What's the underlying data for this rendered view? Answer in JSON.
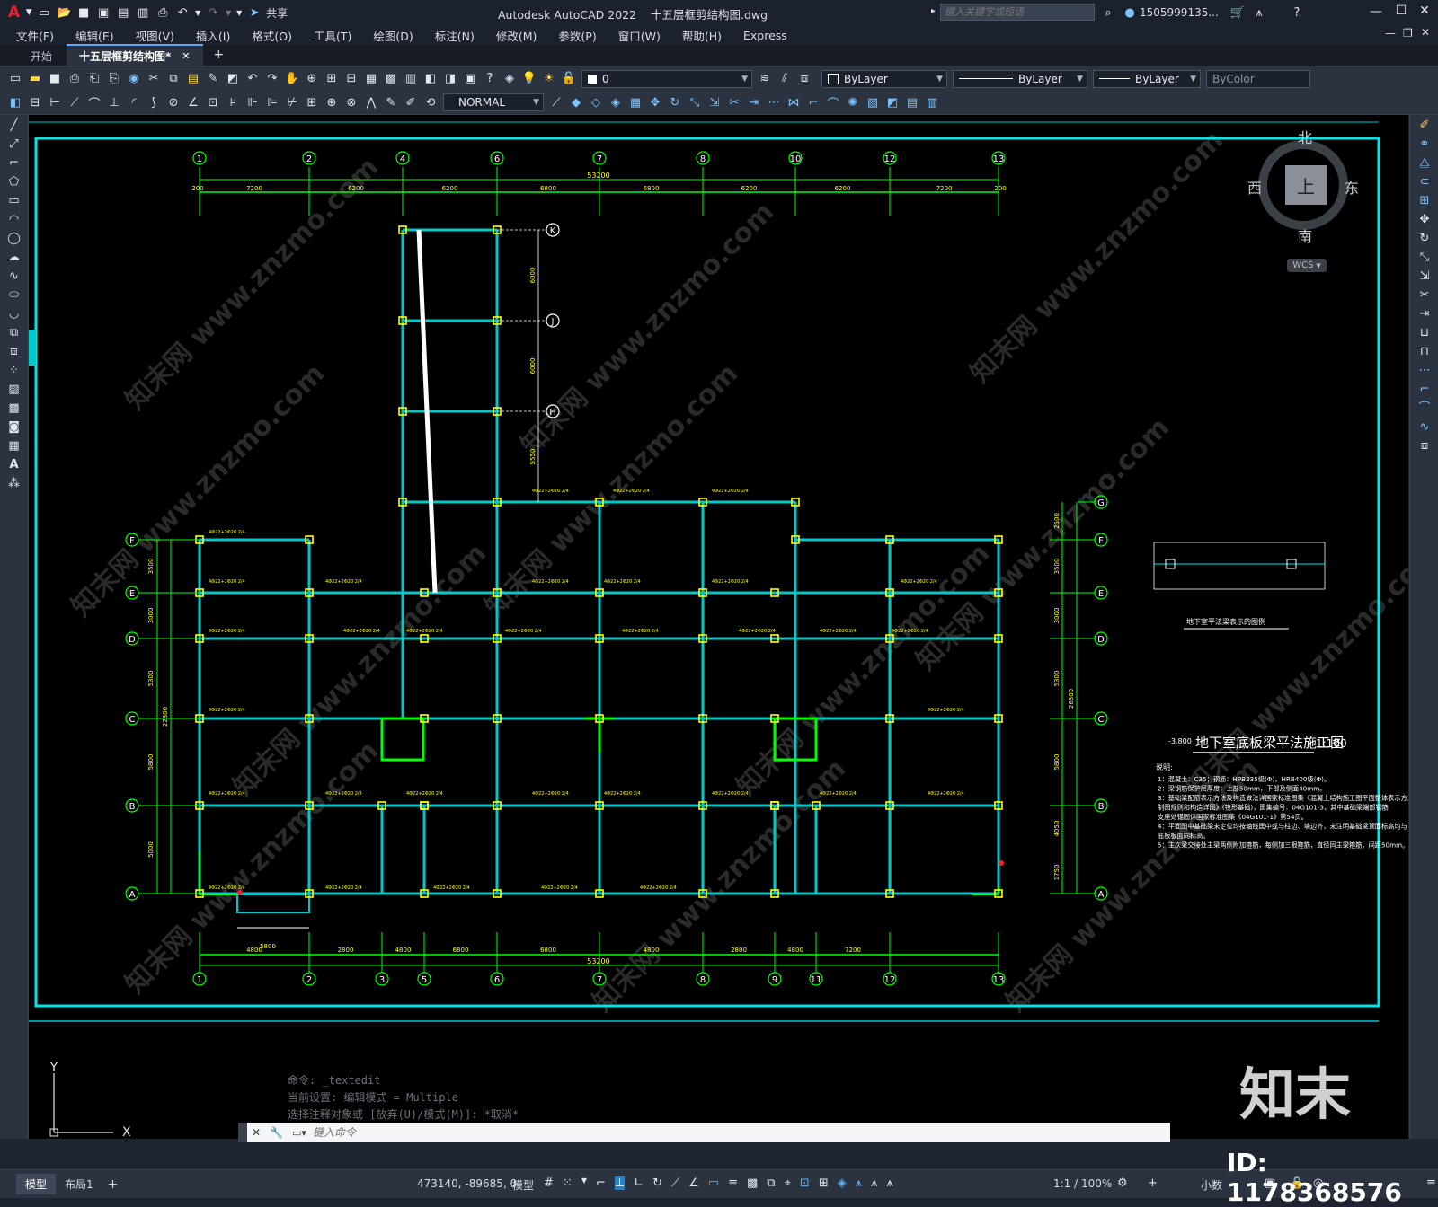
{
  "app": {
    "title": "Autodesk AutoCAD 2022",
    "filename": "十五层框剪结构图.dwg",
    "share_label": "共享",
    "search_placeholder": "键入关键字或短语",
    "user": "1505999135...",
    "logo": "A"
  },
  "menu": [
    "文件(F)",
    "编辑(E)",
    "视图(V)",
    "插入(I)",
    "格式(O)",
    "工具(T)",
    "绘图(D)",
    "标注(N)",
    "修改(M)",
    "参数(P)",
    "窗口(W)",
    "帮助(H)",
    "Express"
  ],
  "tabs": [
    {
      "label": "开始",
      "active": false
    },
    {
      "label": "十五层框剪结构图*",
      "active": true
    }
  ],
  "toolbar": {
    "layer_value": "0",
    "color_value": "ByLayer",
    "linetype_value": "ByLayer",
    "lineweight_value": "ByLayer",
    "plotstyle_value": "ByColor",
    "textstyle_value": "NORMAL"
  },
  "viewcube": {
    "north": "北",
    "south": "南",
    "east": "东",
    "west": "西",
    "top": "上",
    "wcs": "WCS"
  },
  "drawing": {
    "title": "地下室底板梁平法施工图",
    "scale": "1:100",
    "elevation": "-3.800",
    "detail_caption": "地下室平法梁表示的图例",
    "notes_title": "说明:",
    "notes": [
      "1：混凝土：C35；钢筋：HPB235级(Φ)，HRB400级(Φ)。",
      "2：梁钢筋保护层厚度：上部50mm，下部及侧面40mm。",
      "3：基础梁配筋表示方法及构造做法详国家标准图集《混凝土结构施工图平面整体表示方法",
      "   制图规则和构造详图》(筏形基础)，图集编号：04G101-3，其中基础梁端部钢筋",
      "   支座处锚固详国家标准图集《04G101-1》第54页。",
      "4：平面图中基础梁未定位均按轴线居中或与柱边、墙边齐，未注明基础梁顶面标高均与",
      "   底板板面同标高。",
      "5：主次梁交接处主梁两侧附加箍筋，每侧加三根箍筋，直径同主梁箍筋，间距50mm。"
    ],
    "top_axes": [
      "1",
      "2",
      "4",
      "6",
      "7",
      "8",
      "10",
      "12",
      "13"
    ],
    "top_dims": [
      "7200",
      "6200",
      "6200",
      "6800",
      "6800",
      "6200",
      "6200",
      "7200"
    ],
    "top_total": "53200",
    "top_edge": "200",
    "bottom_axes": [
      "1",
      "2",
      "3",
      "5",
      "6",
      "7",
      "8",
      "9",
      "11",
      "12",
      "13"
    ],
    "bottom_dims": [
      "4800",
      "2800",
      "4800",
      "6800",
      "6800",
      "4800",
      "2800",
      "4800",
      "7200"
    ],
    "bottom_total": "53200",
    "bottom_extra": "5800",
    "row_axes": [
      "A",
      "B",
      "C",
      "D",
      "E",
      "F"
    ],
    "left_dims": [
      "5000",
      "5800",
      "5300",
      "3000",
      "3500"
    ],
    "left_total": "22800",
    "upper_row_axes": [
      "K",
      "J",
      "H",
      "G"
    ],
    "upper_dims": [
      "6000",
      "6000",
      "5550"
    ],
    "right_dims": [
      "1750",
      "4050",
      "5800",
      "5300",
      "3000",
      "3500",
      "2500"
    ],
    "right_total": "26300",
    "beam_label": "4Φ22+2Φ20 2/4"
  },
  "command": {
    "history": [
      "命令: _textedit",
      "当前设置: 编辑模式 = Multiple",
      "选择注释对象或 [放弃(U)/模式(M)]: *取消*"
    ],
    "placeholder": "键入命令"
  },
  "layout_tabs": [
    "模型",
    "布局1"
  ],
  "status": {
    "coords": "473140, -89685, 0",
    "space": "模型",
    "scale": "1:1 / 100%",
    "units": "小数"
  },
  "watermark": {
    "site": "www.znzmo.com",
    "brand": "知末网",
    "logo": "知末",
    "id": "ID: 1178368576"
  },
  "ucs": {
    "x": "X",
    "y": "Y"
  },
  "colors": {
    "canvas": "#000000",
    "grid": "#00c8c8",
    "axis": "#00ff00",
    "text": "#ffff00",
    "column": "#ffff00",
    "border": "#00e5e5"
  }
}
